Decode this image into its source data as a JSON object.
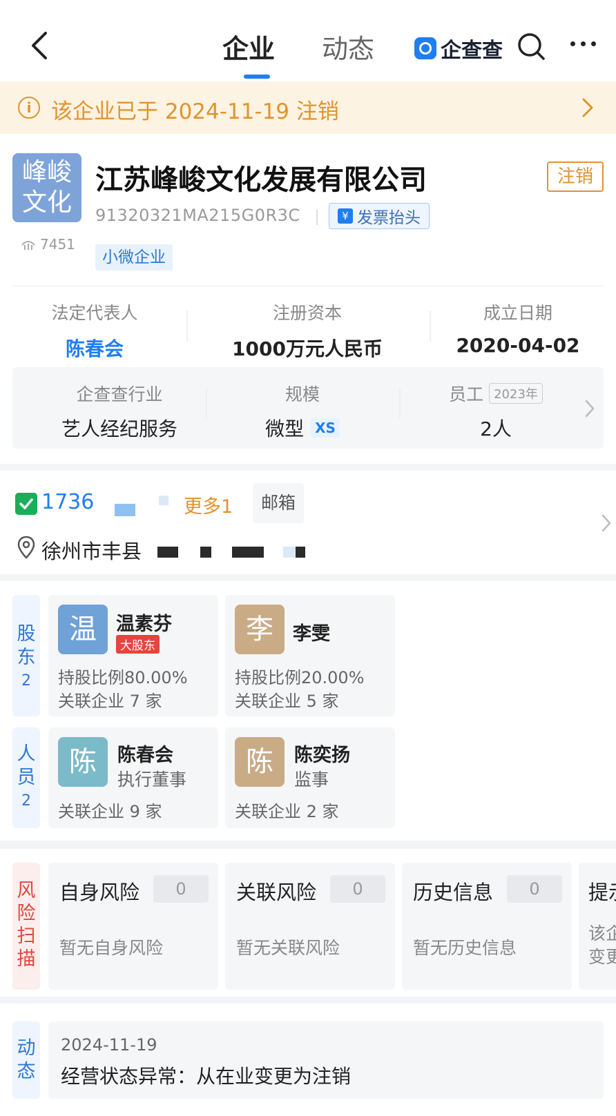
{
  "topbar": {
    "tabs": [
      {
        "label": "企业",
        "active": true
      },
      {
        "label": "动态",
        "active": false
      }
    ],
    "brand": "企查查",
    "accent": "#1f7ef3"
  },
  "notice": {
    "text": "该企业已于 2024-11-19 注销",
    "color": "#e0932e"
  },
  "company": {
    "logo_line1": "峰峻",
    "logo_line2": "文化",
    "views": "7451",
    "name": "江苏峰峻文化发展有限公司",
    "status": "注销",
    "credit_code": "91320321MA215G0R3C",
    "invoice_label": "发票抬头",
    "invoice_symbol": "¥",
    "size_tag": "小微企业"
  },
  "info": [
    {
      "label": "法定代表人",
      "value": "陈春会"
    },
    {
      "label": "注册资本",
      "value": "1000万元人民币"
    },
    {
      "label": "成立日期",
      "value": "2020-04-02"
    }
  ],
  "stats": {
    "industry_label": "企查查行业",
    "industry_value": "艺人经纪服务",
    "scale_label": "规模",
    "scale_value": "微型",
    "scale_badge": "XS",
    "staff_label": "员工",
    "staff_year": "2023年",
    "staff_value": "2人"
  },
  "contact": {
    "phone": "1736",
    "more_phone": "更多1",
    "email_label": "邮箱",
    "address": "徐州市丰县"
  },
  "shareholders": {
    "side_label": [
      "股",
      "东"
    ],
    "count": "2",
    "items": [
      {
        "avatar": "温",
        "avatar_color": "#6fa2d6",
        "name": "温素芬",
        "tag": "大股东",
        "ratio": "持股比例80.00%",
        "related": "关联企业 7 家"
      },
      {
        "avatar": "李",
        "avatar_color": "#c9ab86",
        "name": "李雯",
        "tag": "",
        "ratio": "持股比例20.00%",
        "related": "关联企业 5 家"
      }
    ]
  },
  "staff": {
    "side_label": [
      "人",
      "员"
    ],
    "count": "2",
    "items": [
      {
        "avatar": "陈",
        "avatar_color": "#7bbac9",
        "name": "陈春会",
        "role": "执行董事",
        "related": "关联企业 9 家"
      },
      {
        "avatar": "陈",
        "avatar_color": "#c9ab86",
        "name": "陈奕扬",
        "role": "监事",
        "related": "关联企业 2 家"
      }
    ]
  },
  "risk": {
    "side_label": [
      "风",
      "险",
      "扫",
      "描"
    ],
    "items": [
      {
        "title": "自身风险",
        "count": "0",
        "desc": "暂无自身风险"
      },
      {
        "title": "关联风险",
        "count": "0",
        "desc": "暂无关联风险"
      },
      {
        "title": "历史信息",
        "count": "0",
        "desc": "暂无历史信息"
      }
    ],
    "partial": {
      "title": "提示",
      "desc1": "该企",
      "desc2": "变更"
    }
  },
  "news": {
    "side_label": [
      "动",
      "态"
    ],
    "date": "2024-11-19",
    "text": "经营状态异常：从在业变更为注销"
  }
}
